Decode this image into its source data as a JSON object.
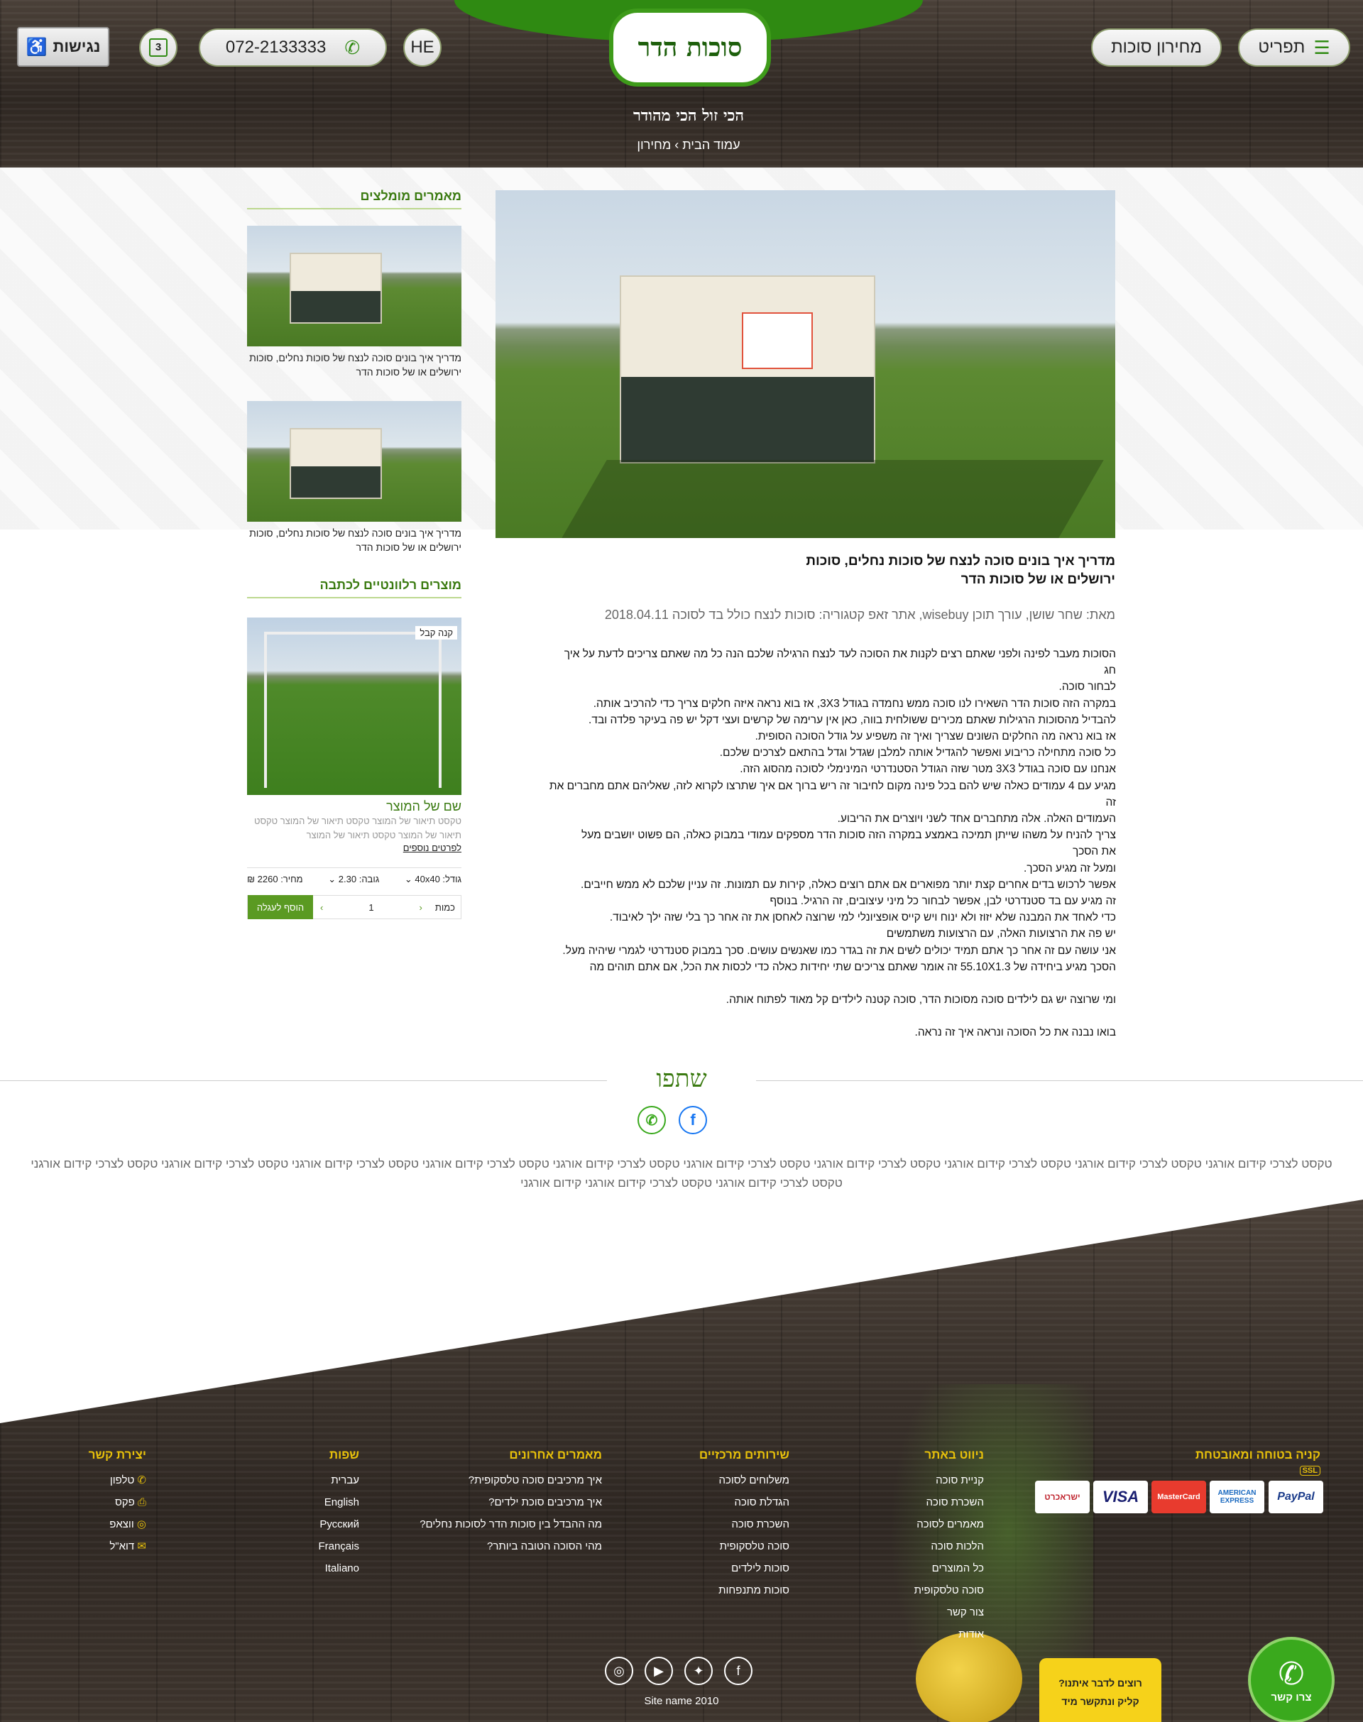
{
  "header": {
    "menu_label": "תפריט",
    "pricelist_label": "מחירון סוכות",
    "lang_label": "HE",
    "phone": "072-2133333",
    "cart_count": "3",
    "accessibility_label": "נגישות",
    "logo_text": "סוכות הדר",
    "slogan": "הכי זול הכי מהודר",
    "breadcrumb": "עמוד הבית › מחירון"
  },
  "article": {
    "title_line1": "מדריך איך בונים סוכה לנצח של סוכות נחלים, סוכות",
    "title_line2": "ירושלים או של סוכות הדר",
    "meta": "מאת: שחר שושן, עורך תוכן wisebuy, אתר זאפ  קטגוריה: סוכות לנצח כולל בד לסוכה  2018.04.11",
    "paragraphs": [
      "הסוכות מעבר לפינה ולפני שאתם רצים לקנות את הסוכה לעד לנצח הרגילה שלכם הנה כל מה שאתם צריכים לדעת על איך",
      "חג",
      "לבחור סוכה.",
      "במקרה הזה סוכות הדר השאירו לנו סוכה ממש נחמדה בגודל 3X3, אז בוא נראה איזה חלקים צריך כדי להרכיב אותה.",
      "להבדיל מהסוכות הרגילות שאתם מכירים ששולחית בווה, כאן אין ערימה של קרשים ועצי דקל יש פה בעיקר פלדה ובד.",
      "אז בוא נראה מה החלקים השונים שצריך ואיך זה משפיע על גודל הסוכה הסופית.",
      "כל סוכה מתחילה כריבוע ואפשר להגדיל אותה למלבן שגדל וגדל בהתאם לצרכים שלכם.",
      "אנחנו עם סוכה בגודל 3X3 מטר שזה הגודל הסטנדרטי המינימלי לסוכה מהסוג הזה.",
      "מגיע עם 4 עמודים כאלה שיש להם בכל פינה מקום לחיבור זה ריש ברוך אם איך שתרצו לקרוא לזה, שאליהם אתם מחברים את",
      "זה",
      "העמודים האלה. אלה מתחברים אחד לשני ויוצרים את הריבוע.",
      "צריך להניח על משהו שייתן תמיכה באמצע במקרה הזה סוכות הדר מספקים עמודי במבוק כאלה, הם פשוט יושבים מעל",
      "את הסכך",
      "ומעל זה מגיע הסכך.",
      "אפשר לרכוש בדים אחרים קצת יותר מפוארים אם אתם רוצים כאלה, קירות עם תמונות. זה עניין שלכם לא ממש חייבים.",
      "זה מגיע עם בד סטנדרטי לבן, אפשר לבחור כל מיני עיצובים, זה הרגיל. בנוסף",
      "כדי לאחד את המבנה שלא יזוז ולא ינוח ויש קייס אופציונלי למי שרוצה לאחסן את זה אחר כך בלי שזה ילך לאיבוד.",
      "יש פה את הרצועות האלה, עם הרצועות משתמשים",
      "אני עושה עם זה אחר כך אתם תמיד יכולים לשים את זה בגדר כמו שאנשים עושים. סכך במבוק סטנדרטי לגמרי שיהיה מעל.",
      "הסכך מגיע ביחידה של 55.10X1.3 זה אומר שאתם צריכים שתי יחידות כאלה כדי לכסות את הכל, אם אתם תוהים מה",
      "",
      "ומי שרוצה יש גם לילדים סוכה מסוכות הדר, סוכה קטנה לילדים קל מאוד לפתוח אותה.",
      "",
      "בואו נבנה את כל הסוכה ונראה איך זה נראה."
    ]
  },
  "sidebar": {
    "recommended_title": "מאמרים מומלצים",
    "recommended": [
      {
        "caption": "מדריך איך בונים סוכה לנצח של סוכות נחלים, סוכות ירושלים או של סוכות הדר"
      },
      {
        "caption": "מדריך איך בונים סוכה לנצח של סוכות נחלים, סוכות ירושלים או של סוכות הדר"
      }
    ],
    "products_title": "מוצרים רלוונטיים לכתבה",
    "product": {
      "badge": "קנה קבל",
      "name": "שם של המוצר",
      "desc": "טקסט תיאור של המוצר טקסט תיאור של המוצר טקסט תיאור של המוצר טקסט תיאור של המוצר",
      "more": "לפרטים נוספים",
      "size": "גודל: 40x40",
      "height": "גובה: 2.30",
      "price": "מחיר: 2260 ₪",
      "qty_label": "כמות",
      "qty": "1",
      "add": "הוסף לעגלה"
    }
  },
  "share": {
    "title": "שתפו",
    "facebook": "f",
    "whatsapp": "✆"
  },
  "seo_text": "טקסט לצרכי קידום אורגני טקסט לצרכי קידום אורגני טקסט לצרכי קידום אורגני טקסט לצרכי קידום אורגני טקסט לצרכי קידום אורגני טקסט לצרכי קידום אורגני טקסט לצרכי קידום אורגני טקסט לצרכי קידום אורגני טקסט לצרכי קידום אורגני טקסט לצרכי קידום אורגני טקסט לצרכי קידום אורגני טקסט לצרכי קידום אורגני  קידום אורגני",
  "footer": {
    "secure_title": "קניה בטוחה ומאובטחת",
    "payments": [
      "PayPal",
      "AMERICAN EXPRESS",
      "MasterCard",
      "VISA",
      "ישראכרט"
    ],
    "nav_title": "ניווט באתר",
    "nav": [
      "קניית סוכה",
      "השכרת סוכה",
      "מאמרים לסוכה",
      "הלכות סוכה",
      "כל המוצרים",
      "סוכה טלסקופית",
      "צור קשר",
      "אודות"
    ],
    "services_title": "שירותים מרכזיים",
    "services": [
      "משלוחים לסוכה",
      "הגדלת סוכה",
      "השכרת סוכה",
      "סוכה טלסקופית",
      "סוכות לילדים",
      "סוכות מתנפחות"
    ],
    "articles_title": "מאמרים אחרונים",
    "articles": [
      "איך מרכיבים סוכה טלסקופית?",
      "איך מרכיבים סוכת ילדים?",
      "מה ההבדל בין סוכות הדר לסוכות נחלים?",
      "מהי הסוכה הטובה ביותר?"
    ],
    "langs_title": "שפות",
    "langs": [
      "עברית",
      "English",
      "Русский",
      "Français",
      "Italiano"
    ],
    "contact_title": "יצירת קשר",
    "contact": [
      "טלפון",
      "פקס",
      "ווצאפ",
      "דוא\"ל"
    ],
    "copyright": "Site name 2010",
    "talk_line1": "רוצים לדבר איתנו?",
    "talk_line2": "קליק ונתקשר מיד",
    "whatsapp_label": "צרו קשר"
  }
}
